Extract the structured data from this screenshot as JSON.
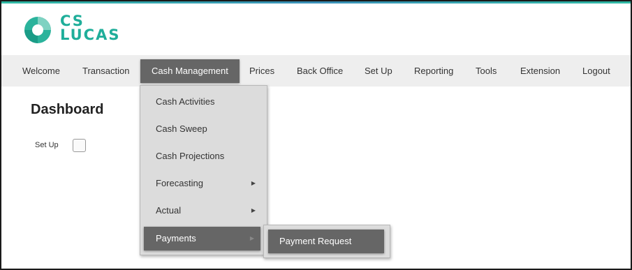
{
  "brand": {
    "line1": "CS",
    "line2": "LUCAS",
    "color": "#1fae9a"
  },
  "nav": {
    "items": [
      {
        "label": "Welcome"
      },
      {
        "label": "Transaction"
      },
      {
        "label": "Cash Management",
        "active": true
      },
      {
        "label": "Prices"
      },
      {
        "label": "Back Office"
      },
      {
        "label": "Set Up"
      },
      {
        "label": "Reporting"
      },
      {
        "label": "Tools"
      },
      {
        "label": "Extension"
      },
      {
        "label": "Logout"
      }
    ],
    "background": "#eeeeee",
    "active_background": "#666666"
  },
  "dashboard": {
    "title": "Dashboard",
    "setup_label": "Set Up",
    "setup_checked": false
  },
  "dropdown": {
    "items": [
      {
        "label": "Cash Activities"
      },
      {
        "label": "Cash Sweep"
      },
      {
        "label": "Cash Projections"
      },
      {
        "label": "Forecasting",
        "submenu": true
      },
      {
        "label": "Actual",
        "submenu": true
      },
      {
        "label": "Payments",
        "submenu": true,
        "active": true
      }
    ],
    "arrow": "▶"
  },
  "submenu": {
    "items": [
      {
        "label": "Payment Request"
      }
    ]
  }
}
